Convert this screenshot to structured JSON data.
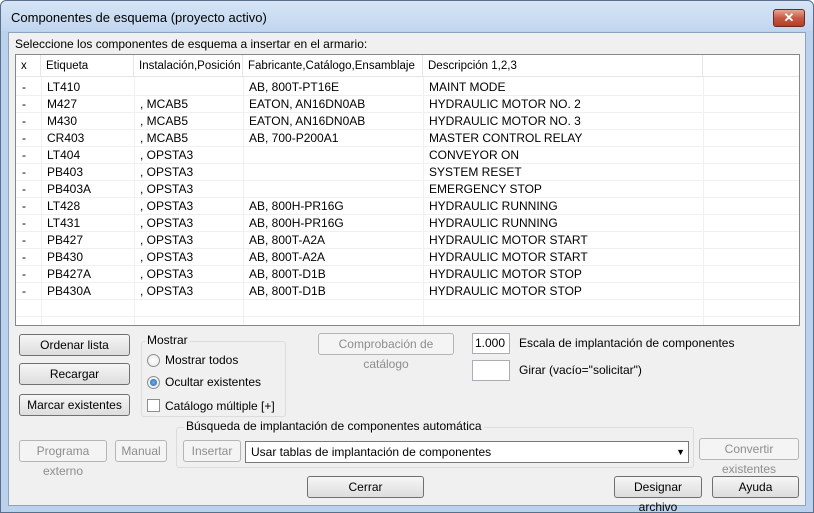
{
  "window": {
    "title": "Componentes de esquema (proyecto activo)",
    "close_glyph": "✕"
  },
  "prompt": "Seleccione los componentes de esquema a insertar en el armario:",
  "list": {
    "columns": [
      "x",
      "Etiqueta",
      "Instalación,Posición",
      "Fabricante,Catálogo,Ensamblaje",
      "Descripción 1,2,3"
    ],
    "rows": [
      [
        "-",
        "LT410",
        "",
        "AB, 800T-PT16E",
        "MAINT MODE"
      ],
      [
        "-",
        "M427",
        ", MCAB5",
        "EATON, AN16DN0AB",
        "HYDRAULIC MOTOR NO. 2"
      ],
      [
        "-",
        "M430",
        ", MCAB5",
        "EATON, AN16DN0AB",
        "HYDRAULIC MOTOR NO. 3"
      ],
      [
        "-",
        "CR403",
        ", MCAB5",
        "AB, 700-P200A1",
        "MASTER CONTROL RELAY"
      ],
      [
        "-",
        "LT404",
        ", OPSTA3",
        "",
        "CONVEYOR ON"
      ],
      [
        "-",
        "PB403",
        ", OPSTA3",
        "",
        "SYSTEM RESET"
      ],
      [
        "-",
        "PB403A",
        ", OPSTA3",
        "",
        "EMERGENCY STOP"
      ],
      [
        "-",
        "LT428",
        ", OPSTA3",
        "AB, 800H-PR16G",
        "HYDRAULIC RUNNING"
      ],
      [
        "-",
        "LT431",
        ", OPSTA3",
        "AB, 800H-PR16G",
        "HYDRAULIC RUNNING"
      ],
      [
        "-",
        "PB427",
        ", OPSTA3",
        "AB, 800T-A2A",
        "HYDRAULIC MOTOR START"
      ],
      [
        "-",
        "PB430",
        ", OPSTA3",
        "AB, 800T-A2A",
        "HYDRAULIC MOTOR START"
      ],
      [
        "-",
        "PB427A",
        ", OPSTA3",
        "AB, 800T-D1B",
        "HYDRAULIC MOTOR STOP"
      ],
      [
        "-",
        "PB430A",
        ", OPSTA3",
        "AB, 800T-D1B",
        "HYDRAULIC MOTOR STOP"
      ]
    ]
  },
  "buttons": {
    "sort": "Ordenar lista",
    "reload": "Recargar",
    "mark_existing": "Marcar existentes",
    "catalog_check": "Comprobación de catálogo",
    "external_program": "Programa externo",
    "manual": "Manual",
    "insert": "Insertar",
    "convert_existing": "Convertir existentes",
    "close": "Cerrar",
    "design_file": "Designar archivo",
    "help": "Ayuda"
  },
  "show_group": {
    "label": "Mostrar",
    "show_all": "Mostrar todos",
    "hide_existing": "Ocultar existentes",
    "selected": "hide_existing",
    "multi_catalog": "Catálogo múltiple [+]",
    "multi_catalog_checked": false
  },
  "scale": {
    "value": "1.000",
    "label": "Escala de implantación de componentes"
  },
  "rotate": {
    "value": "",
    "label": "Girar (vacío=\"solicitar\")"
  },
  "auto_search": {
    "label": "Búsqueda de implantación de componentes automática",
    "selected_option": "Usar tablas de implantación de componentes"
  }
}
